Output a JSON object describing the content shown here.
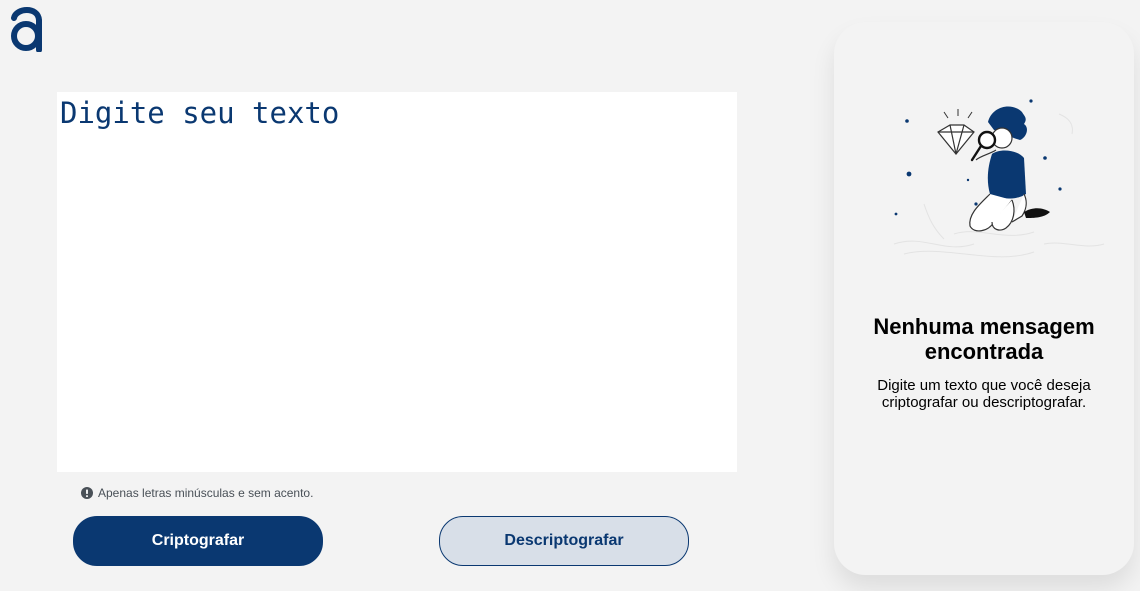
{
  "brand": {
    "logo_icon": "alura-a-logo-icon"
  },
  "editor": {
    "placeholder": "Digite seu texto",
    "value": ""
  },
  "hint": {
    "icon": "exclamation-circle-icon",
    "text": "Apenas letras minúsculas e sem acento."
  },
  "actions": {
    "encrypt_label": "Criptografar",
    "decrypt_label": "Descriptografar"
  },
  "output": {
    "illustration": "person-with-magnifying-glass-illustration",
    "title": "Nenhuma mensagem encontrada",
    "description": "Digite um texto que você deseja criptografar ou descriptografar."
  },
  "colors": {
    "background": "#f3f3f3",
    "accent": "#0a3871",
    "secondary_button": "#d8dfe8",
    "text_area": "#ffffff"
  }
}
